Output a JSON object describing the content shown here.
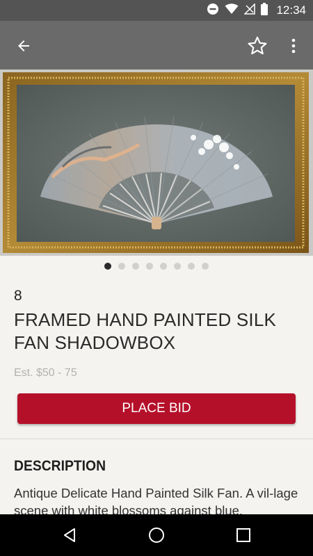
{
  "status_bar": {
    "time": "12:34"
  },
  "app_bar": {
    "back_icon": "arrow-back-icon",
    "favorite_icon": "star-outline-icon",
    "menu_icon": "more-vert-icon"
  },
  "carousel": {
    "total": 8,
    "active_index": 0
  },
  "lot": {
    "number": "8",
    "title": "FRAMED HAND PAINTED SILK FAN SHADOWBOX",
    "estimate": "Est. $50 - 75"
  },
  "actions": {
    "place_bid_label": "PLACE BID"
  },
  "description": {
    "heading": "DESCRIPTION",
    "text": "Antique Delicate Hand Painted Silk Fan. A vil-lage scene with white blossoms against blue."
  },
  "colors": {
    "accent": "#b5102a",
    "app_bar": "#6a6a6a",
    "status_bar": "#545454",
    "background": "#f5f3f0"
  }
}
